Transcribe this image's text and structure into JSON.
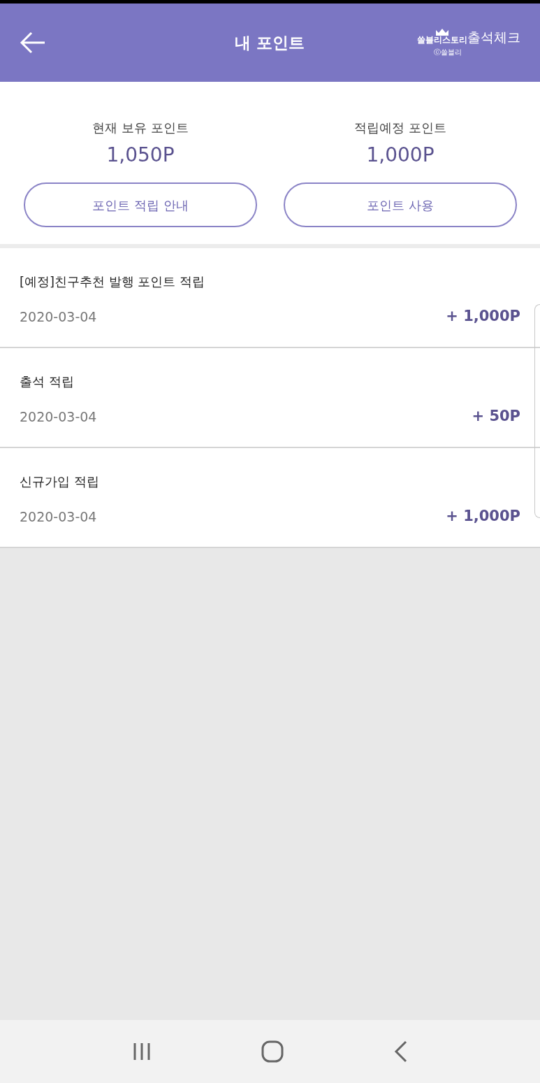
{
  "header": {
    "title": "내 포인트",
    "logo": {
      "brand": "쏠블리스토리",
      "label": "출석체크",
      "copyright": "ⓒ쏠블리"
    }
  },
  "summary": [
    {
      "label": "현재 보유 포인트",
      "value": "1,050P",
      "button": "포인트 적립 안내"
    },
    {
      "label": "적립예정 포인트",
      "value": "1,000P",
      "button": "포인트 사용"
    }
  ],
  "history": [
    {
      "title": "[예정]친구추천 발행 포인트 적립",
      "date": "2020-03-04",
      "amount": "+ 1,000P"
    },
    {
      "title": "출석 적립",
      "date": "2020-03-04",
      "amount": "+ 50P"
    },
    {
      "title": "신규가입 적립",
      "date": "2020-03-04",
      "amount": "+ 1,000P"
    }
  ]
}
